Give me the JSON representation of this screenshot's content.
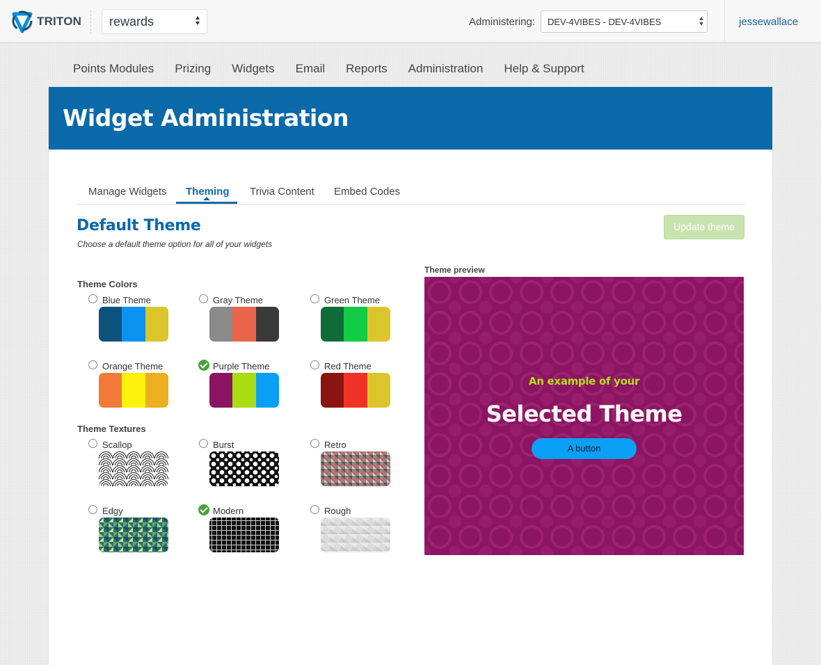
{
  "header": {
    "logo_text": "TRITON",
    "app_select_value": "rewards",
    "admin_label": "Administering:",
    "admin_select_value": "DEV-4VIBES - DEV-4VIBES",
    "username": "jessewallace"
  },
  "nav": {
    "items": [
      "Points Modules",
      "Prizing",
      "Widgets",
      "Email",
      "Reports",
      "Administration",
      "Help & Support"
    ]
  },
  "banner": {
    "title": "Widget Administration"
  },
  "tabs": {
    "items": [
      "Manage Widgets",
      "Theming",
      "Trivia Content",
      "Embed Codes"
    ],
    "active": "Theming"
  },
  "section": {
    "title": "Default Theme",
    "subtitle": "Choose a default theme option for all of your widgets",
    "update_button": "Update theme"
  },
  "theme_colors": {
    "label": "Theme Colors",
    "options": [
      {
        "label": "Blue Theme",
        "selected": false,
        "colors": [
          "#0d527a",
          "#0b93f2",
          "#dcc52a"
        ]
      },
      {
        "label": "Gray Theme",
        "selected": false,
        "colors": [
          "#8a8a8a",
          "#e8654a",
          "#3a3a3a"
        ]
      },
      {
        "label": "Green Theme",
        "selected": false,
        "colors": [
          "#0f6b3a",
          "#11cc44",
          "#dcc52a"
        ]
      },
      {
        "label": "Orange Theme",
        "selected": false,
        "colors": [
          "#f47a3a",
          "#fff20a",
          "#ebaf1f"
        ]
      },
      {
        "label": "Purple Theme",
        "selected": true,
        "colors": [
          "#8c1464",
          "#aadc14",
          "#0a9ef5"
        ]
      },
      {
        "label": "Red Theme",
        "selected": false,
        "colors": [
          "#8a1410",
          "#ef3326",
          "#dcc52a"
        ]
      }
    ]
  },
  "theme_textures": {
    "label": "Theme Textures",
    "options": [
      {
        "label": "Scallop",
        "selected": false,
        "texture": "scallop"
      },
      {
        "label": "Burst",
        "selected": false,
        "texture": "burst"
      },
      {
        "label": "Retro",
        "selected": false,
        "texture": "retro"
      },
      {
        "label": "Edgy",
        "selected": false,
        "texture": "edgy"
      },
      {
        "label": "Modern",
        "selected": true,
        "texture": "modern"
      },
      {
        "label": "Rough",
        "selected": false,
        "texture": "rough"
      }
    ]
  },
  "preview": {
    "label": "Theme preview",
    "subtitle": "An example of your",
    "title": "Selected Theme",
    "button": "A button",
    "colors": {
      "background": "#8b1562",
      "accent": "#b5de1c",
      "button": "#0aa0f5"
    }
  },
  "icons": {
    "logo": "triton-logo-icon",
    "select_arrows": "select-arrows-icon",
    "checkmark": "checkmark-icon"
  }
}
